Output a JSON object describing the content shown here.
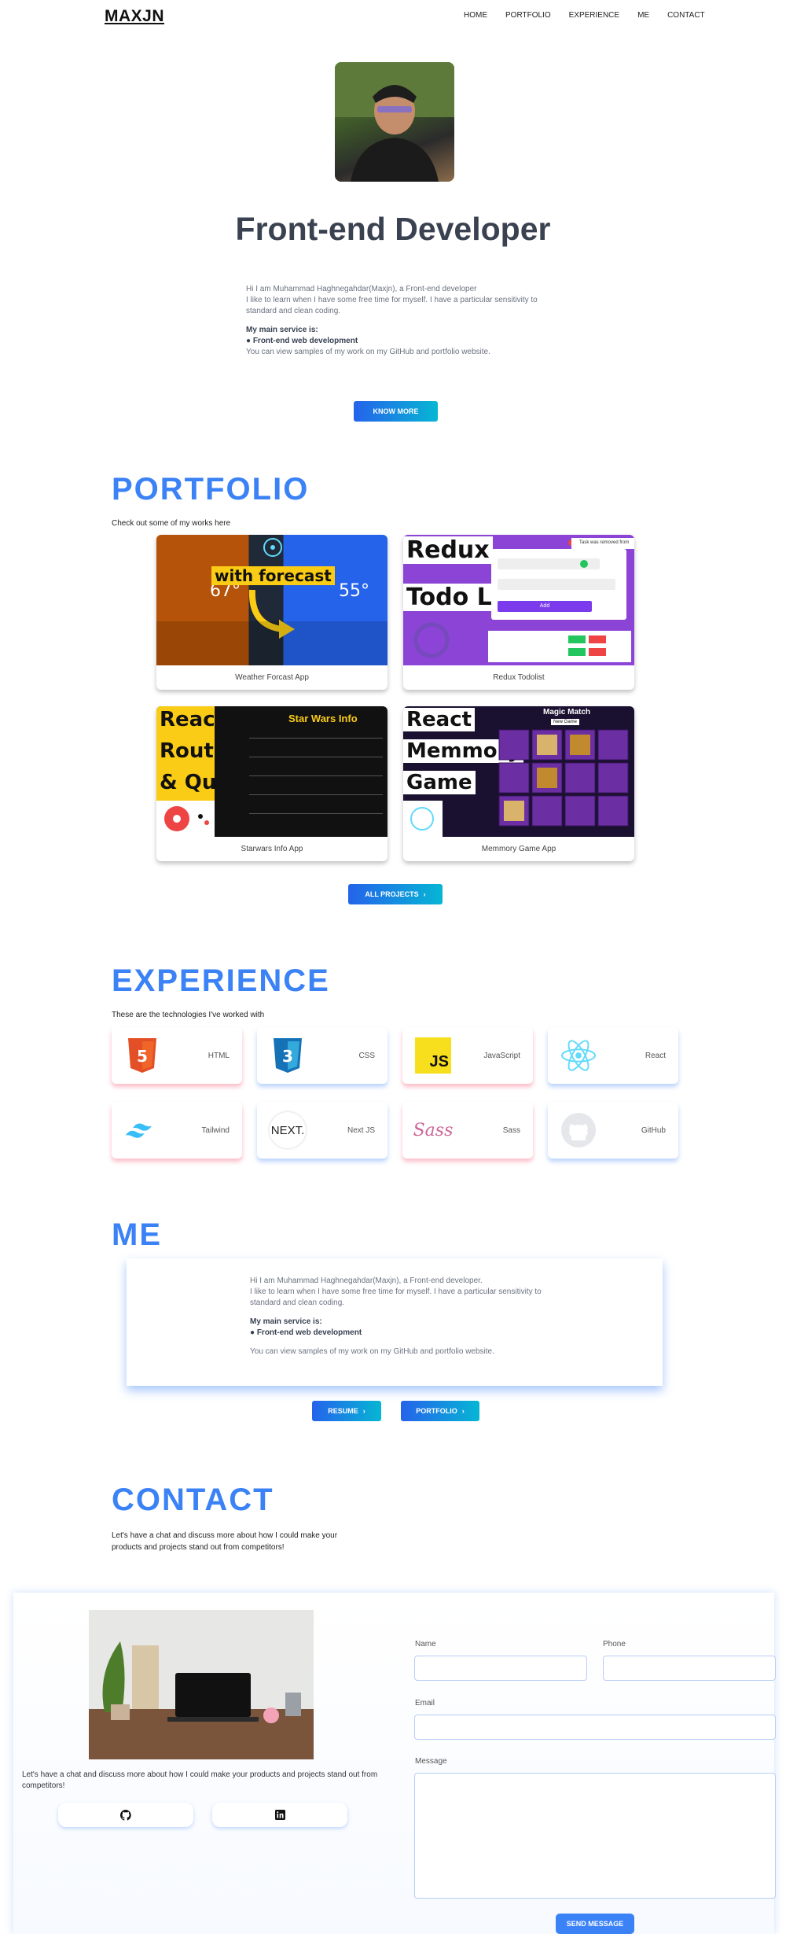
{
  "header": {
    "logo": "MAXJN",
    "nav": [
      "HOME",
      "PORTFOLIO",
      "EXPERIENCE",
      "ME",
      "CONTACT"
    ]
  },
  "hero": {
    "title": "Front-end Developer",
    "intro1": "Hi I am Muhammad Haghnegahdar(Maxjn), a Front-end developer",
    "intro2": "I like to learn when I have some free time for myself. I have a particular sensitivity to standard and clean coding.",
    "service_label": "My main service is:",
    "service": "● Front-end web development",
    "samples": "You can view samples of my work on my GitHub and portfolio website.",
    "button": "KNOW MORE"
  },
  "portfolio": {
    "title": "PORTFOLIO",
    "subtitle": "Check out some of my works here",
    "items": [
      {
        "caption": "Weather Forcast App",
        "overlay": "with forecast"
      },
      {
        "caption": "Redux Todolist",
        "overlay1": "Redux",
        "overlay2": "Todo List",
        "toast": "Task was removed from",
        "add": "Add"
      },
      {
        "caption": "Starwars Info App",
        "overlay1": "React",
        "overlay2": "Router",
        "overlay3": "& Query",
        "heading": "Star Wars Info"
      },
      {
        "caption": "Memmory Game App",
        "overlay1": "React",
        "overlay2": "Memmory",
        "overlay3": "Game",
        "heading": "Magic Match",
        "new_game": "New Game"
      }
    ],
    "button": "ALL PROJECTS"
  },
  "experience": {
    "title": "EXPERIENCE",
    "subtitle": "These are the technologies I've worked with",
    "items": [
      {
        "name": "HTML",
        "icon": "html5-icon",
        "color": "#e34f26"
      },
      {
        "name": "CSS",
        "icon": "css3-icon",
        "color": "#1572b6"
      },
      {
        "name": "JavaScript",
        "icon": "javascript-icon",
        "color": "#f7df1e"
      },
      {
        "name": "React",
        "icon": "react-icon",
        "color": "#61dafb"
      },
      {
        "name": "Tailwind",
        "icon": "tailwind-icon",
        "color": "#38bdf8"
      },
      {
        "name": "Next JS",
        "icon": "nextjs-icon",
        "color": "#000000"
      },
      {
        "name": "Sass",
        "icon": "sass-icon",
        "color": "#cd6799"
      },
      {
        "name": "GitHub",
        "icon": "github-icon",
        "color": "#24292e"
      }
    ]
  },
  "me": {
    "title": "ME",
    "line1": "Hi I am Muhammad Haghnegahdar(Maxjn), a Front-end developer.",
    "line2": "I like to learn when I have some free time for myself. I have a particular sensitivity to standard and clean coding.",
    "service_label": "My main service is:",
    "service": "● Front-end web development",
    "samples": "You can view samples of my work on my GitHub and portfolio website.",
    "resume_button": "RESUME",
    "portfolio_button": "PORTFOLIO"
  },
  "contact": {
    "title": "CONTACT",
    "subtitle": "Let's have a chat and discuss more about how I could make your products and projects stand out from competitors!",
    "left_text": "Let's have a chat and discuss more about how I could make your products and projects stand out from competitors!",
    "form": {
      "name_label": "Name",
      "phone_label": "Phone",
      "email_label": "Email",
      "message_label": "Message",
      "name_value": "",
      "phone_value": "",
      "email_value": "",
      "message_value": "",
      "submit": "SEND MESSAGE"
    }
  }
}
